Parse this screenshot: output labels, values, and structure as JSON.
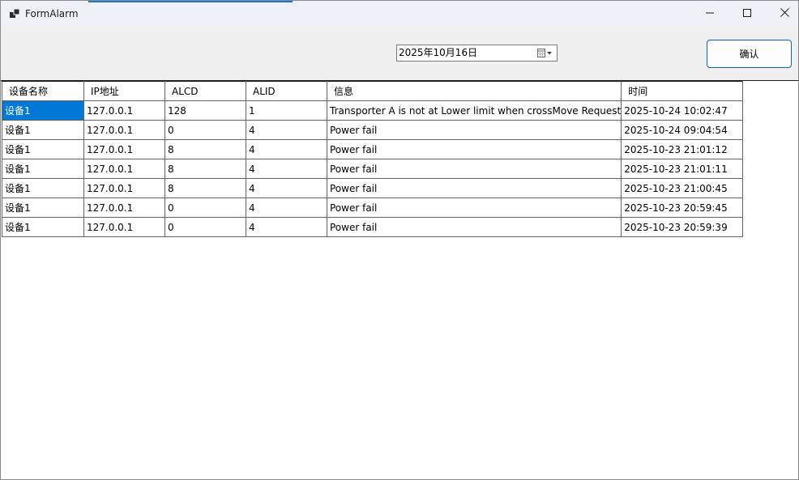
{
  "window": {
    "title": "FormAlarm",
    "accent_color": "#1a73d6"
  },
  "titlebar_buttons": {
    "minimize_icon": "minimize-icon",
    "maximize_icon": "maximize-icon",
    "close_icon": "close-icon"
  },
  "toolbar": {
    "date_value": "2025年10月16日",
    "calendar_icon": "calendar-dropdown-icon",
    "confirm_label": "确认"
  },
  "table": {
    "columns": [
      "设备名称",
      "IP地址",
      "ALCD",
      "ALID",
      "信息",
      "时间"
    ],
    "selected_color": "#0078d7",
    "rows": [
      [
        "设备1",
        "127.0.0.1",
        "128",
        "1",
        "Transporter A is not at Lower limit when crossMove Request",
        "2025-10-24 10:02:47"
      ],
      [
        "设备1",
        "127.0.0.1",
        "0",
        "4",
        "Power fail",
        "2025-10-24 09:04:54"
      ],
      [
        "设备1",
        "127.0.0.1",
        "8",
        "4",
        "Power fail",
        "2025-10-23 21:01:12"
      ],
      [
        "设备1",
        "127.0.0.1",
        "8",
        "4",
        "Power fail",
        "2025-10-23 21:01:11"
      ],
      [
        "设备1",
        "127.0.0.1",
        "8",
        "4",
        "Power fail",
        "2025-10-23 21:00:45"
      ],
      [
        "设备1",
        "127.0.0.1",
        "0",
        "4",
        "Power fail",
        "2025-10-23 20:59:45"
      ],
      [
        "设备1",
        "127.0.0.1",
        "0",
        "4",
        "Power fail",
        "2025-10-23 20:59:39"
      ]
    ]
  }
}
